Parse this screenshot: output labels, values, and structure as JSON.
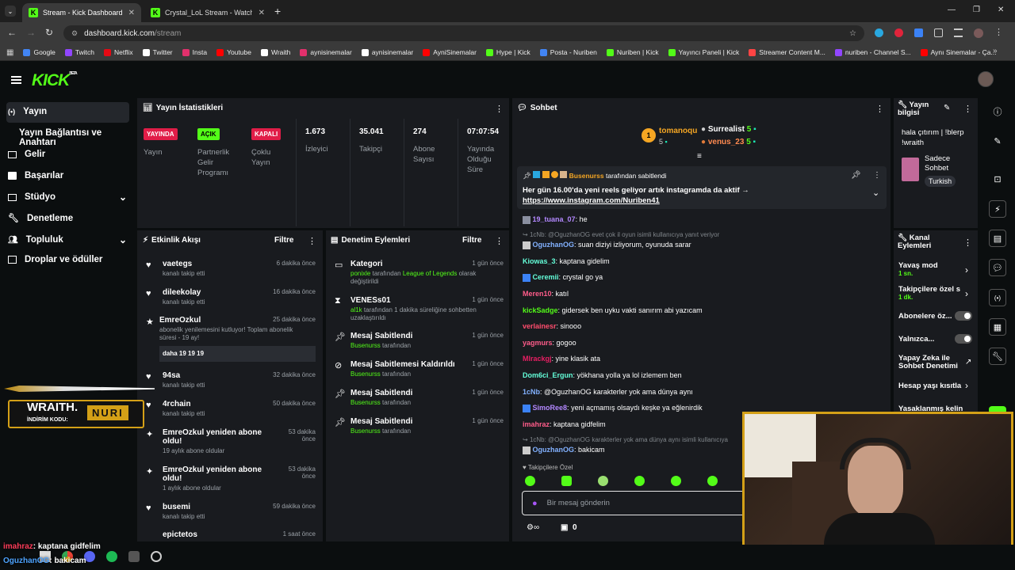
{
  "browser": {
    "tabs": [
      {
        "label": "Stream - Kick Dashboard"
      },
      {
        "label": "Crystal_LoL Stream - Watch Live"
      }
    ],
    "url_host": "dashboard.kick.com",
    "url_path": "/stream",
    "bookmarks": [
      {
        "label": "Google",
        "color": "#4285f4"
      },
      {
        "label": "Twitch",
        "color": "#9146ff"
      },
      {
        "label": "Netflix",
        "color": "#e50914"
      },
      {
        "label": "Twitter",
        "color": "#ffffff"
      },
      {
        "label": "Insta",
        "color": "#e1306c"
      },
      {
        "label": "Youtube",
        "color": "#ff0000"
      },
      {
        "label": "Wraith",
        "color": "#ffffff"
      },
      {
        "label": "aynisinemalar",
        "color": "#e1306c"
      },
      {
        "label": "aynisinemalar",
        "color": "#ffffff"
      },
      {
        "label": "AyniSinemalar",
        "color": "#ff0000"
      },
      {
        "label": "Hype | Kick",
        "color": "#53fc18"
      },
      {
        "label": "Posta - Nuriben",
        "color": "#4285f4"
      },
      {
        "label": "Nuriben | Kick",
        "color": "#53fc18"
      },
      {
        "label": "Yayıncı Paneli | Kick",
        "color": "#53fc18"
      },
      {
        "label": "Streamer Content M...",
        "color": "#ff4444"
      },
      {
        "label": "nuriben - Channel S...",
        "color": "#9146ff"
      },
      {
        "label": "Aynı Sinemalar - Ça...",
        "color": "#ff0000"
      }
    ]
  },
  "app": {
    "logo": "KICK",
    "beta": "BETA"
  },
  "sidebar": {
    "items": [
      {
        "label": "Yayın",
        "icon": "broadcast-icon"
      },
      {
        "label": "Yayın Bağlantısı ve Anahtarı"
      },
      {
        "label": "Gelir",
        "icon": "dollar-icon"
      },
      {
        "label": "Başarılar",
        "icon": "trophy-icon"
      },
      {
        "label": "Stüdyo",
        "icon": "studio-icon"
      },
      {
        "label": "Denetleme",
        "icon": "wrench-icon"
      },
      {
        "label": "Topluluk",
        "icon": "people-icon"
      },
      {
        "label": "Droplar ve ödüller",
        "icon": "gift-icon"
      }
    ]
  },
  "stats": {
    "title": "Yayın İstatistikleri",
    "badges": [
      {
        "badge": "YAYINDA",
        "label": "Yayın",
        "color": "#e11d48"
      },
      {
        "badge": "AÇIK",
        "label": "Partnerlik Gelir Programı",
        "color": "#53fc18"
      },
      {
        "badge": "KAPALI",
        "label": "Çoklu Yayın",
        "color": "#e11d48"
      }
    ],
    "numbers": [
      {
        "value": "1.673",
        "label": "İzleyici"
      },
      {
        "value": "35.041",
        "label": "Takipçi"
      },
      {
        "value": "274",
        "label": "Abone Sayısı"
      },
      {
        "value": "07:07:54",
        "label": "Yayında Olduğu Süre"
      }
    ]
  },
  "activity": {
    "title": "Etkinlik Akışı",
    "filter": "Filtre",
    "items": [
      {
        "user": "vaetegs",
        "desc": "kanalı takip etti",
        "time": "6 dakika önce"
      },
      {
        "user": "dileekolay",
        "desc": "kanalı takip etti",
        "time": "16 dakika önce"
      },
      {
        "user": "EmreOzkul",
        "desc": "abonelik yenilemesini kutluyor! Toplam abonelik süresi - 19 ay!",
        "time": "25 dakika önce",
        "message": "daha 19 19 19"
      },
      {
        "user": "94sa",
        "desc": "kanalı takip etti",
        "time": "32 dakika önce"
      },
      {
        "user": "4rchain",
        "desc": "kanalı takip etti",
        "time": "50 dakika önce"
      },
      {
        "user": "EmreOzkul yeniden abone oldu!",
        "desc": "19 aylık abone oldular",
        "time": "53 dakika önce"
      },
      {
        "user": "EmreOzkul yeniden abone oldu!",
        "desc": "1 aylık abone oldular",
        "time": "53 dakika önce"
      },
      {
        "user": "busemi",
        "desc": "kanalı takip etti",
        "time": "59 dakika önce"
      },
      {
        "user": "epictetos",
        "desc": "",
        "time": "1 saat önce"
      }
    ]
  },
  "moderation": {
    "title": "Denetim Eylemleri",
    "filter": "Filtre",
    "items": [
      {
        "title": "Kategori",
        "actor": "ponixle",
        "desc": "tarafından",
        "target": "League of Legends",
        "desc2": "olarak değiştirildi",
        "time": "1 gün önce"
      },
      {
        "title": "VENESs01",
        "actor": "al1k",
        "desc": "tarafından 1 dakika süreliğine sohbetten uzaklaştırıldı",
        "time": "1 gün önce"
      },
      {
        "title": "Mesaj Sabitlendi",
        "actor": "Busenurss",
        "desc": "tarafından",
        "time": "1 gün önce"
      },
      {
        "title": "Mesaj Sabitlemesi Kaldırıldı",
        "actor": "Busenurss",
        "desc": "tarafından",
        "time": "1 gün önce"
      },
      {
        "title": "Mesaj Sabitlendi",
        "actor": "Busenurss",
        "desc": "tarafından",
        "time": "1 gün önce"
      },
      {
        "title": "Mesaj Sabitlendi",
        "actor": "Busenurss",
        "desc": "tarafından",
        "time": "1 gün önce"
      }
    ]
  },
  "chat": {
    "title": "Sohbet",
    "gifters": [
      {
        "rank": "1",
        "name": "tomanoqu",
        "count": "5"
      },
      {
        "name": "Surrealist",
        "count": "5"
      },
      {
        "name": "venus_23",
        "count": "5"
      }
    ],
    "pinned": {
      "by_user": "Busenurss",
      "by_text": "tarafından sabitlendi",
      "text": "Her gün 16.00'da yeni reels geliyor artık instagramda da aktif →",
      "link": "https://www.instagram.com/Nuriben41"
    },
    "messages": [
      {
        "user": "19_tuana_07",
        "text": "he",
        "color": "#b388ff"
      },
      {
        "reply": "1cNb: @OguzhanOG evet çok il oyun isimli kullanıcıya yanıt veriyor"
      },
      {
        "user": "OguzhanOG",
        "text": "suan diziyi izliyorum, oyunuda sarar",
        "color": "#82b1ff"
      },
      {
        "user": "Kiowas_3",
        "text": "kaptana gidelim",
        "color": "#64ffda"
      },
      {
        "user": "Ceremii",
        "text": "crystal go ya",
        "color": "#64ffda"
      },
      {
        "user": "Meren10",
        "text": "katıl",
        "color": "#ff5c8a"
      },
      {
        "user": "kickSadge",
        "text": "gidersek ben uyku vakti sanırım abi yazıcam",
        "color": "#53fc18"
      },
      {
        "user": "verlainesr",
        "text": "sinooo",
        "color": "#ff4d6d"
      },
      {
        "user": "yagmurs",
        "text": "gogoo",
        "color": "#ff5c8a"
      },
      {
        "user": "Mlrackgj",
        "text": "yine klasik ata",
        "color": "#e91e63"
      },
      {
        "user": "Dom6ci_Ergun",
        "text": "yökhana yolla ya lol izlemem ben",
        "color": "#64ffda"
      },
      {
        "user": "1cNb",
        "text": "@OguzhanOG karakterler yok ama dünya aynı",
        "color": "#82b1ff"
      },
      {
        "user": "SimoRee8",
        "text": "yeni açmamış olsaydı keşke ya eğlenirdik",
        "color": "#b388ff"
      },
      {
        "user": "imahraz",
        "text": "kaptana gidfelim",
        "color": "#ff5c8a"
      },
      {
        "reply": "1cNb: @OguzhanOG karakterler yok ama dünya aynı isimli kullanıcıya"
      },
      {
        "user": "OguzhanOG",
        "text": "bakicam",
        "color": "#82b1ff"
      }
    ],
    "followers_only": "Takipçilere Özel",
    "input_placeholder": "Bir mesaj gönderin",
    "kicks_count": "0"
  },
  "stream_info": {
    "title": "Yayın bilgisi",
    "stream_title": "hala çıtırım | !blerp !wraith",
    "category": "Sadece Sohbet",
    "language": "Turkish"
  },
  "channel_actions": {
    "title": "Kanal Eylemleri",
    "items": [
      {
        "label": "Yavaş mod",
        "sub": "1 sn."
      },
      {
        "label": "Takipçilere özel s",
        "sub": "1 dk."
      },
      {
        "label": "Abonelere öz..."
      },
      {
        "label": "Yalnızca..."
      },
      {
        "label": "Yapay Zeka ile Sohbet Denetimi"
      },
      {
        "label": "Hesap yaşı kısıtla"
      },
      {
        "label": "Yasaklanmış kelin"
      }
    ]
  },
  "overlay": {
    "brand": "WRAITH.",
    "code_label": "İNDİRİM KODU:",
    "code": "NURI",
    "ticker": [
      {
        "user": "imahraz",
        "text": ": kaptana gidfelim"
      },
      {
        "user": "OguzhanOG",
        "text": ": bakicam"
      }
    ]
  }
}
